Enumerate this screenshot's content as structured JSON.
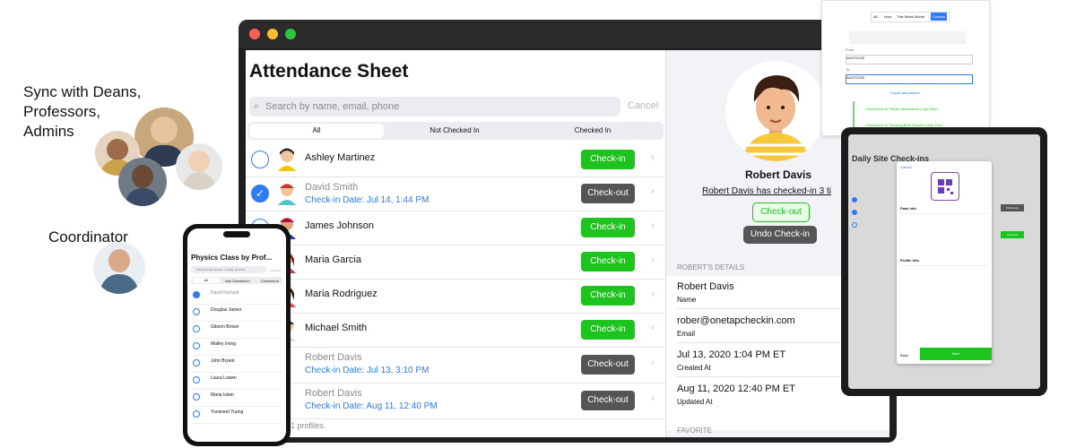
{
  "marketing": {
    "sync_line1": "Sync with Deans,",
    "sync_line2": "Professors,",
    "sync_line3": "Admins",
    "coordinator": "Coordinator"
  },
  "laptop": {
    "title": "Attendance Sheet",
    "search_placeholder": "Search by name, email, phone",
    "cancel": "Cancel",
    "tabs": [
      "All",
      "Not Checked In",
      "Checked In"
    ],
    "rows": [
      {
        "name": "Ashley Martinez",
        "status": "",
        "button": "Check-in"
      },
      {
        "name": "David Smith",
        "status": "Check-in Date: Jul 14, 1:44 PM",
        "button": "Check-out"
      },
      {
        "name": "James Johnson",
        "status": "",
        "button": "Check-in"
      },
      {
        "name": "Maria Garcia",
        "status": "",
        "button": "Check-in"
      },
      {
        "name": "Maria Rodriguez",
        "status": "",
        "button": "Check-in"
      },
      {
        "name": "Michael Smith",
        "status": "",
        "button": "Check-in"
      },
      {
        "name": "Robert Davis",
        "status": "Check-in Date: Jul 13, 3:10 PM",
        "button": "Check-out"
      },
      {
        "name": "Robert Davis",
        "status": "Check-in Date: Aug 11, 12:40 PM",
        "button": "Check-out"
      }
    ],
    "footer": "1 profiles.",
    "detail": {
      "name": "Robert Davis",
      "message": "Robert Davis has checked-in 3 ti",
      "checkout_btn": "Check-out",
      "undo_btn": "Undo Check-in",
      "section": "ROBERT'S DETAILS",
      "fields": [
        {
          "value": "Robert Davis",
          "label": "Name"
        },
        {
          "value": "rober@onetapcheckin.com",
          "label": "Email"
        },
        {
          "value": "Jul 13, 2020 1:04 PM ET",
          "label": "Created At"
        },
        {
          "value": "Aug 11, 2020 12:40 PM ET",
          "label": "Updated At"
        }
      ],
      "favorite": "FAVORITE"
    }
  },
  "phone": {
    "title": "Physics Class by Prof...",
    "search": "Search by name, email, phone",
    "cancel": "Cancel",
    "tabs": [
      "All",
      "Not Checked In",
      "Checked In"
    ],
    "people": [
      "David Richard",
      "Douglas James",
      "Gibson Brown",
      "Malley Irving",
      "John Bryant",
      "Laura Lowen",
      "Maria Islam",
      "Yuvaneet Yuong"
    ]
  },
  "tablet": {
    "title": "Daily Site Check-ins",
    "modal_cancel": "Cancel",
    "section1": "Pass info",
    "section2": "Profile Info",
    "back": "Back",
    "next": "Next",
    "check_btns": [
      "Check-out",
      "Check-in",
      "Check-out",
      "Check-in"
    ]
  },
  "paper": {
    "tabs": [
      "All",
      "Hour",
      "This Week",
      "Month",
      "Custom"
    ],
    "from": "From",
    "to": "To",
    "date_from": "04/07/2020",
    "date_to": "04/07/2020",
    "export": "Export Attendance",
    "event1": "Checked-in at \"Hadler Attendance (July 11th)\"",
    "event2": "Checked-in at \"Morning Bem Session (July 11th)\""
  },
  "colors": {
    "green": "#1ec41e",
    "blue": "#2f7bf6",
    "dark_btn": "#555555"
  }
}
